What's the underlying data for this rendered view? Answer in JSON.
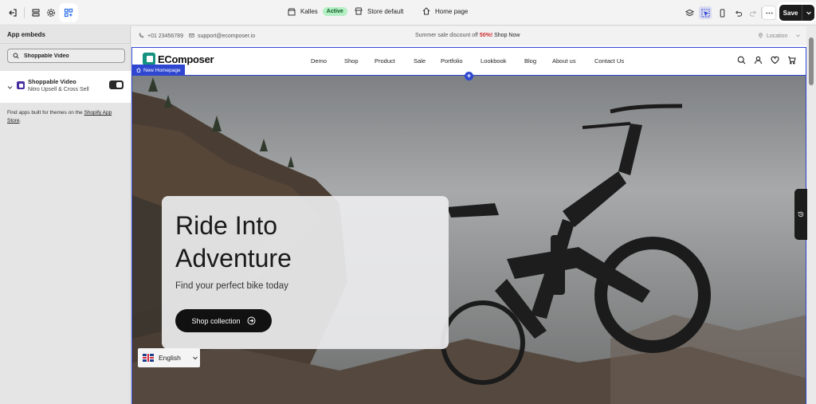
{
  "topbar": {
    "store_name": "Kalles",
    "store_status": "Active",
    "store_default": "Store default",
    "page_name": "Home page",
    "save_label": "Save"
  },
  "panel": {
    "title": "App embeds",
    "search_value": "Shoppable Video",
    "embed": {
      "name": "Shoppable Video",
      "vendor": "Nitro Upsell & Cross Sell",
      "enabled": true
    },
    "note_prefix": "Find apps built for themes on the ",
    "note_link": "Shopify App Store",
    "note_suffix": "."
  },
  "preview": {
    "announcement": {
      "phone": "+01 23456789",
      "email": "support@ecomposer.io",
      "promo_prefix": "Summer sale discount off ",
      "promo_off": "50%!",
      "promo_link": "Shop Now",
      "location": "Location"
    },
    "logo_text": "EComposer",
    "nav": [
      "Demo",
      "Shop",
      "Product",
      "Sale",
      "Portfolio",
      "Lookbook",
      "Blog",
      "About us",
      "Contact Us"
    ],
    "page_tag": "New Homepage",
    "hero": {
      "title_line1": "Ride Into",
      "title_line2": "Adventure",
      "subtitle": "Find your perfect bike today",
      "button": "Shop collection"
    },
    "language": "English"
  },
  "colors": {
    "accent_blue": "#2f47d0",
    "active_badge_bg": "#b4f0c4",
    "promo_red": "#d12b2b"
  }
}
